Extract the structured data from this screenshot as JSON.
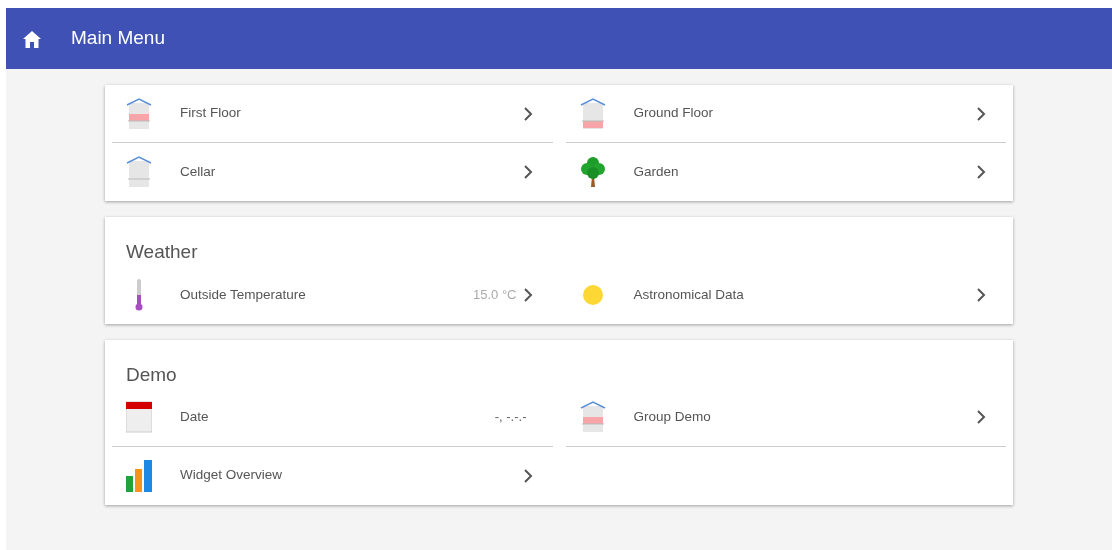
{
  "header": {
    "title": "Main Menu"
  },
  "cards": [
    {
      "items": [
        {
          "label": "First Floor",
          "kind": "floor-upper",
          "link": true
        },
        {
          "label": "Ground Floor",
          "kind": "floor-lower",
          "link": true
        },
        {
          "label": "Cellar",
          "kind": "cellar",
          "link": true
        },
        {
          "label": "Garden",
          "kind": "tree",
          "link": true
        }
      ]
    },
    {
      "title": "Weather",
      "items": [
        {
          "label": "Outside Temperature",
          "kind": "thermometer",
          "value": "15.0 °C",
          "link": true
        },
        {
          "label": "Astronomical Data",
          "kind": "sun",
          "link": true
        }
      ]
    },
    {
      "title": "Demo",
      "items": [
        {
          "label": "Date",
          "kind": "calendar",
          "value": "-, -.-.-",
          "link": false
        },
        {
          "label": "Group Demo",
          "kind": "floor-upper",
          "link": true
        },
        {
          "label": "Widget Overview",
          "kind": "chart",
          "link": true
        }
      ]
    }
  ]
}
